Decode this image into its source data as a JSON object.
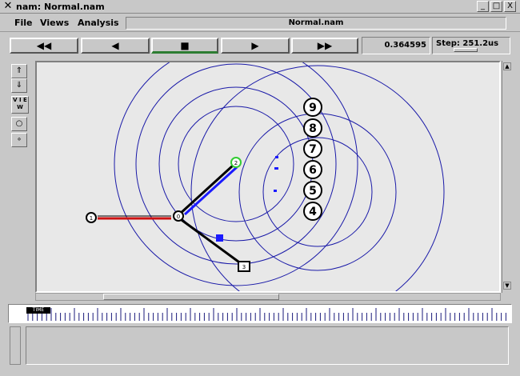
{
  "window": {
    "title": "nam: Normal.nam",
    "min_label": "_",
    "max_label": "□",
    "close_label": "X"
  },
  "menu": {
    "file": "File",
    "views": "Views",
    "analysis": "Analysis",
    "filename": "Normal.nam"
  },
  "controls": {
    "rewind": "◀◀",
    "back": "◀",
    "stop": "■",
    "play": "▶",
    "ffwd": "▶▶",
    "time": "0.364595",
    "step_label": "Step: 251.2us"
  },
  "tools": {
    "view_label": "V I E W"
  },
  "nodes": [
    {
      "id": "0",
      "label": "0"
    },
    {
      "id": "1",
      "label": "1"
    },
    {
      "id": "2",
      "label": "2"
    },
    {
      "id": "3",
      "label": "3"
    },
    {
      "id": "4",
      "label": "4"
    },
    {
      "id": "5",
      "label": "5"
    },
    {
      "id": "6",
      "label": "6"
    },
    {
      "id": "7",
      "label": "7"
    },
    {
      "id": "8",
      "label": "8"
    },
    {
      "id": "9",
      "label": "9"
    }
  ],
  "timeline": {
    "marker_label": "TIME"
  },
  "colors": {
    "wave": "#1a1aa8",
    "link": "#000000",
    "link_red": "#cc1111",
    "link_blue": "#1a1aff",
    "packet": "#1a1aff",
    "node_green": "#33cc33"
  }
}
